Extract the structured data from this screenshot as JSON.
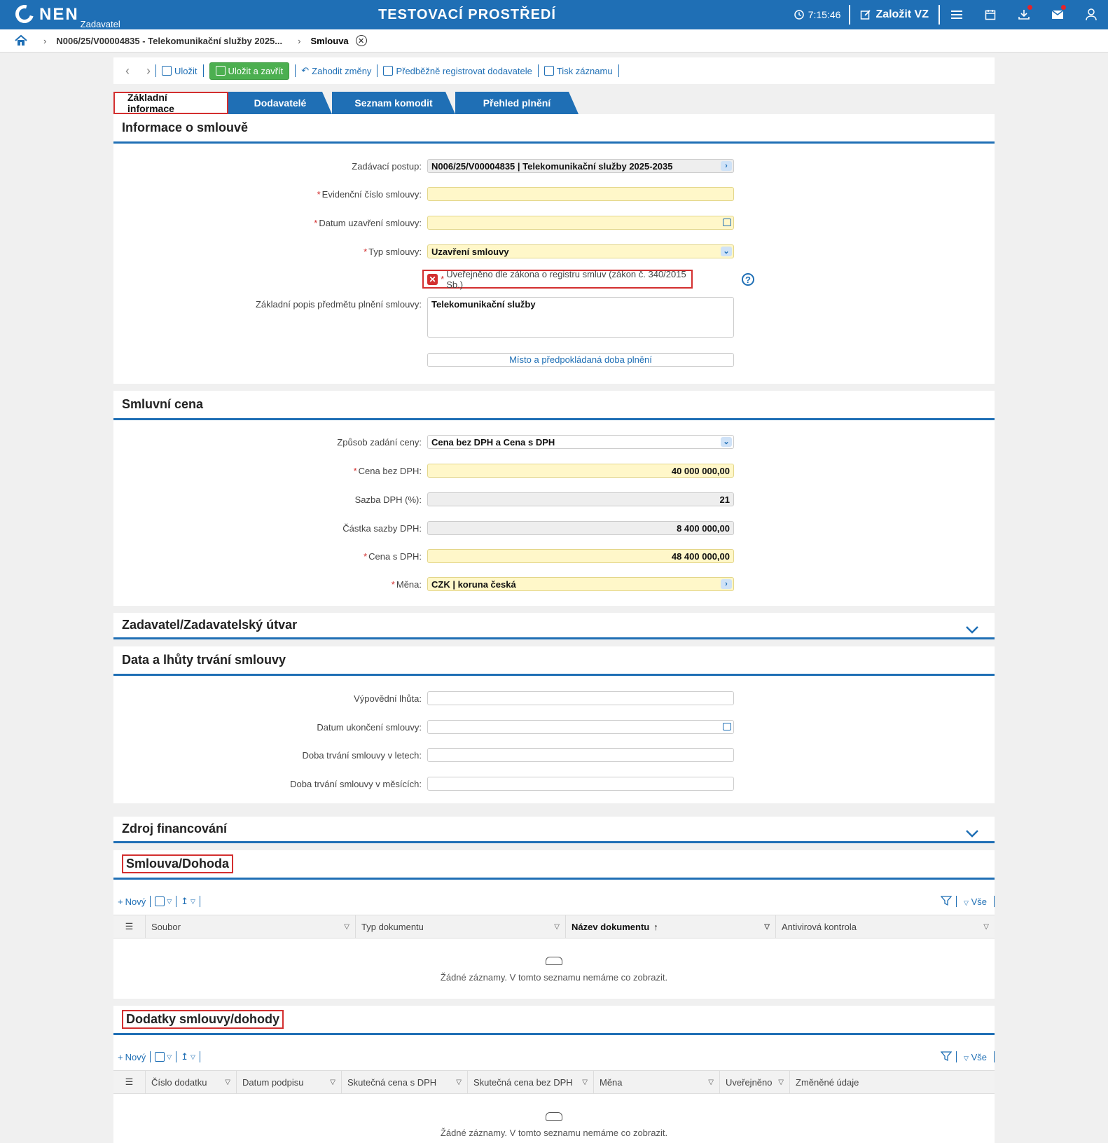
{
  "topbar": {
    "logo_text": "NEN",
    "logo_sub": "Zadavatel",
    "env_title": "TESTOVACÍ PROSTŘEDÍ",
    "clock": "7:15:46",
    "create_label": "Založit VZ",
    "icons": [
      "menu-icon",
      "calendar-icon",
      "download-icon",
      "mail-icon",
      "user-icon"
    ]
  },
  "breadcrumb": {
    "items": [
      "N006/25/V00004835 - Telekomunikační služby 2025...",
      "Smlouva"
    ]
  },
  "toolbar": {
    "save": "Uložit",
    "save_close": "Uložit a zavřít",
    "discard": "Zahodit změny",
    "preregister": "Předběžně registrovat dodavatele",
    "print": "Tisk záznamu"
  },
  "tabs": [
    "Základní informace",
    "Dodavatelé",
    "Seznam komodit",
    "Přehled plnění"
  ],
  "info": {
    "title": "Informace o smlouvě",
    "zadavaci_postup_label": "Zadávací postup:",
    "zadavaci_postup_value": "N006/25/V00004835 | Telekomunikační služby 2025-2035",
    "evidencni_label": "Evidenční číslo smlouvy:",
    "datum_label": "Datum uzavření smlouvy:",
    "typ_label": "Typ smlouvy:",
    "typ_value": "Uzavření smlouvy",
    "published_label": "Uveřejněno dle zákona o registru smluv (zákon č. 340/2015 Sb.)",
    "popis_label": "Základní popis předmětu plnění smlouvy:",
    "popis_value": "Telekomunikační služby",
    "misto_link": "Místo a předpokládaná doba plnění"
  },
  "price": {
    "title": "Smluvní cena",
    "zpusob_label": "Způsob zadání ceny:",
    "zpusob_value": "Cena bez DPH a Cena s DPH",
    "cena_bez_label": "Cena bez DPH:",
    "cena_bez_value": "40 000 000,00",
    "sazba_label": "Sazba DPH (%):",
    "sazba_value": "21",
    "castka_label": "Částka sazby DPH:",
    "castka_value": "8 400 000,00",
    "cena_s_label": "Cena s DPH:",
    "cena_s_value": "48 400 000,00",
    "mena_label": "Měna:",
    "mena_value": "CZK | koruna česká"
  },
  "zadavatel": {
    "title": "Zadavatel/Zadavatelský útvar"
  },
  "terms": {
    "title": "Data a lhůty trvání smlouvy",
    "vypovedni_label": "Výpovědní lhůta:",
    "ukonceni_label": "Datum ukončení smlouvy:",
    "roky_label": "Doba trvání smlouvy v letech:",
    "mesice_label": "Doba trvání smlouvy v měsících:"
  },
  "funding": {
    "title": "Zdroj financování"
  },
  "contract_docs": {
    "title": "Smlouva/Dohoda",
    "new_label": "Nový",
    "all_label": "Vše",
    "columns": [
      "Soubor",
      "Typ dokumentu",
      "Název dokumentu",
      "Antivirová kontrola"
    ],
    "empty": "Žádné záznamy. V tomto seznamu nemáme co zobrazit."
  },
  "amendments": {
    "title": "Dodatky smlouvy/dohody",
    "new_label": "Nový",
    "all_label": "Vše",
    "columns": [
      "Číslo dodatku",
      "Datum podpisu",
      "Skutečná cena s DPH",
      "Skutečná cena bez DPH",
      "Měna",
      "Uveřejněno",
      "Změněné údaje"
    ],
    "empty": "Žádné záznamy. V tomto seznamu nemáme co zobrazit."
  },
  "colors": {
    "primary": "#1f6fb5",
    "accent_green": "#4caf50",
    "required": "#d32f2f",
    "mandatory_field": "#fff7c9"
  }
}
